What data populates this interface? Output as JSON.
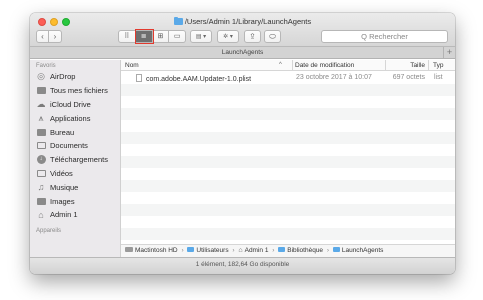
{
  "window": {
    "title": "/Users/Admin 1/Library/LaunchAgents",
    "tab_label": "LaunchAgents",
    "tab_plus": "+"
  },
  "toolbar": {
    "back": "‹",
    "forward": "›",
    "view_icons": "⠿",
    "view_list": "≣",
    "view_columns": "⊞",
    "view_cover": "▭",
    "arrange": "▤ ▾",
    "action": "✲ ▾",
    "share": "⇪",
    "tag": "⬭",
    "search_placeholder": "Q Rechercher"
  },
  "sidebar": {
    "section_favorites": "Favoris",
    "items": [
      {
        "label": "AirDrop",
        "icon": "airdrop-icon"
      },
      {
        "label": "Tous mes fichiers",
        "icon": "all-files-icon"
      },
      {
        "label": "iCloud Drive",
        "icon": "cloud-icon"
      },
      {
        "label": "Applications",
        "icon": "applications-icon"
      },
      {
        "label": "Bureau",
        "icon": "desktop-icon"
      },
      {
        "label": "Documents",
        "icon": "documents-icon"
      },
      {
        "label": "Téléchargements",
        "icon": "downloads-icon"
      },
      {
        "label": "Vidéos",
        "icon": "movies-icon"
      },
      {
        "label": "Musique",
        "icon": "music-icon"
      },
      {
        "label": "Images",
        "icon": "pictures-icon"
      },
      {
        "label": "Admin 1",
        "icon": "home-icon"
      }
    ],
    "section_devices": "Appareils"
  },
  "columns": {
    "name": "Nom",
    "sort_indicator": "^",
    "date": "Date de modification",
    "size": "Taille",
    "type": "Typ"
  },
  "files": [
    {
      "name": "com.adobe.AAM.Updater-1.0.plist",
      "date": "23 octobre 2017 à 10:07",
      "size": "697 octets",
      "type": "list"
    }
  ],
  "pathbar": {
    "disk": "Mactintosh HD",
    "users": "Utilisateurs",
    "home": "Admin 1",
    "library": "Bibliothèque",
    "folder": "LaunchAgents",
    "separator": "›"
  },
  "status": "1 élément, 182,64 Go disponible"
}
